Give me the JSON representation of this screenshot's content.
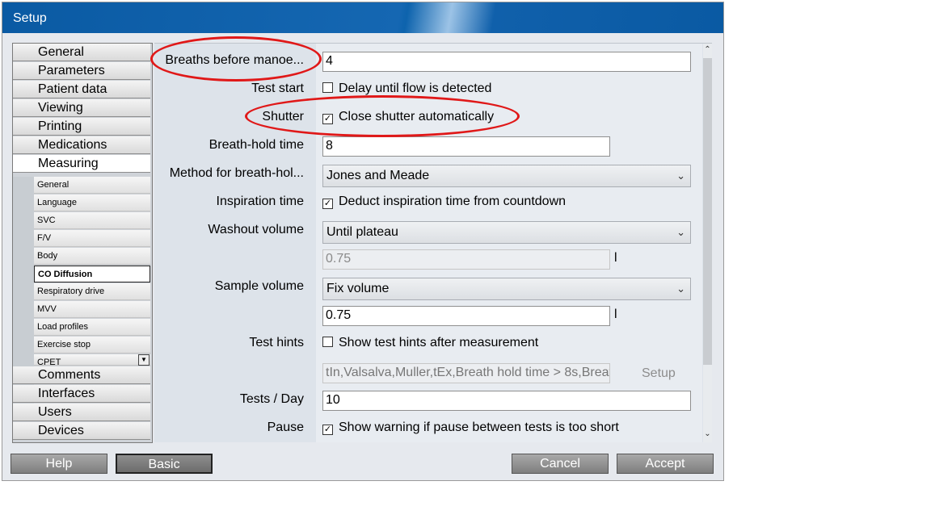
{
  "window": {
    "title": "Setup"
  },
  "nav": {
    "items_top": [
      "General",
      "Parameters",
      "Patient data",
      "Viewing",
      "Printing",
      "Medications",
      "Measuring"
    ],
    "sub_items": [
      "General",
      "Language",
      "SVC",
      "F/V",
      "Body",
      "CO Diffusion",
      "Respiratory drive",
      "MVV",
      "Load profiles",
      "Exercise stop",
      "CPET"
    ],
    "items_bottom": [
      "Comments",
      "Interfaces",
      "Users",
      "Devices"
    ]
  },
  "form": {
    "breaths_label": "Breaths before manoe...",
    "breaths_value": "4",
    "test_start_label": "Test start",
    "test_start_check": "Delay until flow is detected",
    "shutter_label": "Shutter",
    "shutter_check": "Close shutter automatically",
    "breath_hold_label": "Breath-hold time",
    "breath_hold_value": "8",
    "method_label": "Method for breath-hol...",
    "method_value": "Jones and Meade",
    "inspiration_label": "Inspiration time",
    "inspiration_check": "Deduct inspiration time from countdown",
    "washout_label": "Washout volume",
    "washout_value": "Until plateau",
    "washout_amount": "0.75",
    "unit_l": "l",
    "sample_label": "Sample volume",
    "sample_value": "Fix volume",
    "sample_amount": "0.75",
    "hints_label": "Test hints",
    "hints_check": "Show test hints after measurement",
    "hints_list": "tIn,Valsalva,Muller,tEx,Breath hold time > 8s,Breat",
    "hints_setup": "Setup",
    "tests_day_label": "Tests / Day",
    "tests_day_value": "10",
    "pause_label": "Pause",
    "pause_check": "Show warning if pause between tests is too short"
  },
  "buttons": {
    "help": "Help",
    "basic": "Basic",
    "cancel": "Cancel",
    "accept": "Accept"
  },
  "checks": {
    "test_start": false,
    "shutter": true,
    "inspiration": true,
    "hints": false,
    "pause": true
  },
  "icons": {
    "checkmark": "check-mark-icon",
    "dropdown": "chevron-down-icon",
    "scroll_up": "scroll-up-icon",
    "scroll_down": "scroll-down-icon"
  },
  "colors": {
    "titlebar": "#0a5aa3",
    "annotation": "#e01818"
  }
}
